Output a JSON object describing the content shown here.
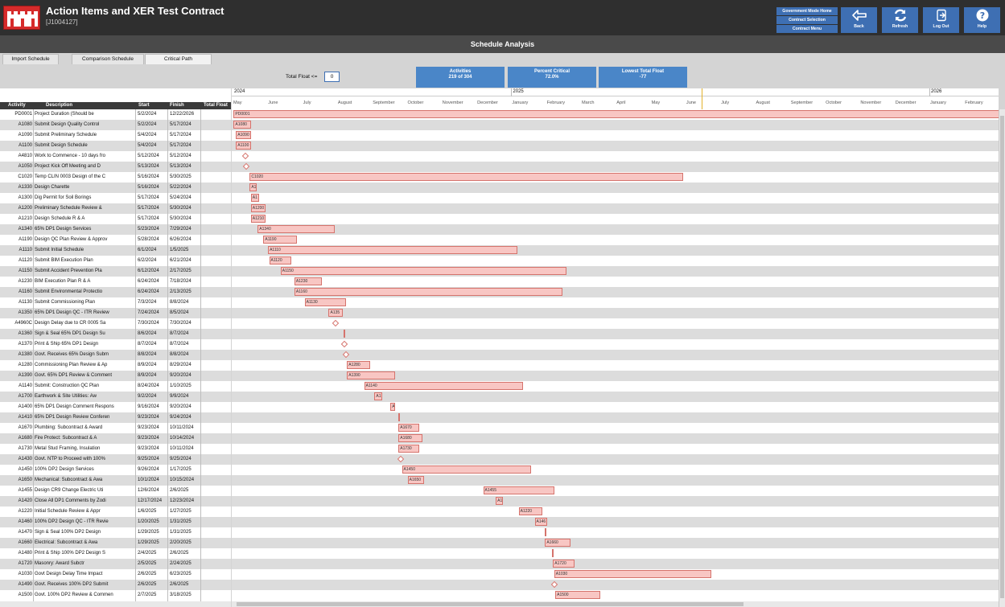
{
  "header": {
    "title": "Action Items and XER Test Contract",
    "subtitle": "[J1004127]",
    "menu_buttons": [
      "Government Mode Home",
      "Contract Selection",
      "Contract Menu"
    ],
    "buttons": [
      {
        "label": "Back",
        "icon": "back-arrow-icon"
      },
      {
        "label": "Refresh",
        "icon": "refresh-icon"
      },
      {
        "label": "Log Out",
        "icon": "logout-icon"
      },
      {
        "label": "Help",
        "icon": "help-icon"
      }
    ]
  },
  "section_title": "Schedule Analysis",
  "tabs": [
    "Import Schedule",
    "Comparison Schedule",
    "Critical Path"
  ],
  "active_tab": "Critical Path",
  "filter": {
    "label": "Total Float <=",
    "value": "0"
  },
  "stats": [
    {
      "title": "Activities",
      "value": "219 of 304"
    },
    {
      "title": "Percent Critical",
      "value": "72.0%"
    },
    {
      "title": "Lowest Total Float",
      "value": "-77"
    }
  ],
  "columns": [
    "Activity",
    "Description",
    "Start",
    "Finish",
    "Total Float"
  ],
  "timeline": {
    "years": [
      "2024",
      "2025",
      "2026"
    ],
    "months": [
      "May",
      "June",
      "July",
      "August",
      "September",
      "October",
      "November",
      "December",
      "January",
      "February",
      "March",
      "April",
      "May",
      "June",
      "July",
      "August",
      "September",
      "October",
      "November",
      "December",
      "January",
      "February"
    ]
  },
  "rows": [
    {
      "id": "PD0001",
      "desc": "Project Duration  (Should be",
      "start": "5/2/2024",
      "finish": "12/22/2026",
      "bar": "PD0001"
    },
    {
      "id": "A1080",
      "desc": "Submit Design Quality Control",
      "start": "5/2/2024",
      "finish": "5/17/2024",
      "bar": "A1080"
    },
    {
      "id": "A1090",
      "desc": "Submit Preliminary Schedule",
      "start": "5/4/2024",
      "finish": "5/17/2024",
      "bar": "A1090"
    },
    {
      "id": "A1100",
      "desc": "Submit Design Schedule",
      "start": "5/4/2024",
      "finish": "5/17/2024",
      "bar": "A1100"
    },
    {
      "id": "A4810",
      "desc": "Work to Commence - 10 days fro",
      "start": "5/12/2024",
      "finish": "5/12/2024",
      "bar": ""
    },
    {
      "id": "A1050",
      "desc": "Project Kick Off Meeting and D",
      "start": "5/13/2024",
      "finish": "5/13/2024",
      "bar": ""
    },
    {
      "id": "C1020",
      "desc": "Temp CLIN 0003 Design of the C",
      "start": "5/16/2024",
      "finish": "5/30/2025",
      "bar": "C1020"
    },
    {
      "id": "A1330",
      "desc": "Design Charette",
      "start": "5/16/2024",
      "finish": "5/22/2024",
      "bar": "A1"
    },
    {
      "id": "A1300",
      "desc": "Dig Permit for Soil Borings",
      "start": "5/17/2024",
      "finish": "5/24/2024",
      "bar": "A1"
    },
    {
      "id": "A1200",
      "desc": "Preliminary Schedule Review &",
      "start": "5/17/2024",
      "finish": "5/30/2024",
      "bar": "A1200"
    },
    {
      "id": "A1210",
      "desc": "Design Schedule R & A",
      "start": "5/17/2024",
      "finish": "5/30/2024",
      "bar": "A1210"
    },
    {
      "id": "A1340",
      "desc": "65% DP1 Design Services",
      "start": "5/23/2024",
      "finish": "7/29/2024",
      "bar": "A1340"
    },
    {
      "id": "A1190",
      "desc": "Design QC Plan Review & Approv",
      "start": "5/28/2024",
      "finish": "6/26/2024",
      "bar": "A1190"
    },
    {
      "id": "A1110",
      "desc": "Submit Initial Schedule",
      "start": "6/1/2024",
      "finish": "1/5/2025",
      "bar": "A1110"
    },
    {
      "id": "A1120",
      "desc": "Submit BIM Execution Plan",
      "start": "6/2/2024",
      "finish": "6/21/2024",
      "bar": "A1120"
    },
    {
      "id": "A1150",
      "desc": "Submit Accident Prevention Pla",
      "start": "6/12/2024",
      "finish": "2/17/2025",
      "bar": "A1150"
    },
    {
      "id": "A1230",
      "desc": "BIM Execution Plan R & A",
      "start": "6/24/2024",
      "finish": "7/18/2024",
      "bar": "A1230"
    },
    {
      "id": "A1160",
      "desc": "Submit Environmental Protectio",
      "start": "6/24/2024",
      "finish": "2/13/2025",
      "bar": "A1160"
    },
    {
      "id": "A1130",
      "desc": "Submit Commissioning Plan",
      "start": "7/3/2024",
      "finish": "8/8/2024",
      "bar": "A1130"
    },
    {
      "id": "A1350",
      "desc": "65% DP1 Design QC - ITR Review",
      "start": "7/24/2024",
      "finish": "8/5/2024",
      "bar": "A135"
    },
    {
      "id": "A4960C",
      "desc": "Design Delay due to CR 0005 Sa",
      "start": "7/30/2024",
      "finish": "7/30/2024",
      "bar": ""
    },
    {
      "id": "A1360",
      "desc": "Sign & Seal 65% DP1  Design Su",
      "start": "8/6/2024",
      "finish": "8/7/2024",
      "bar": ""
    },
    {
      "id": "A1370",
      "desc": "Print & Ship 65% DP1 Design",
      "start": "8/7/2024",
      "finish": "8/7/2024",
      "bar": ""
    },
    {
      "id": "A1380",
      "desc": "Govt. Receives 65% Design Subm",
      "start": "8/8/2024",
      "finish": "8/8/2024",
      "bar": ""
    },
    {
      "id": "A1280",
      "desc": "Commissioning Plan Review & Ap",
      "start": "8/9/2024",
      "finish": "8/29/2024",
      "bar": "A1280"
    },
    {
      "id": "A1390",
      "desc": "Govt. 65% DP1 Review & Comment",
      "start": "8/9/2024",
      "finish": "9/20/2024",
      "bar": "A1390"
    },
    {
      "id": "A1140",
      "desc": "Submit:  Construction QC Plan",
      "start": "8/24/2024",
      "finish": "1/10/2025",
      "bar": "A1140"
    },
    {
      "id": "A1700",
      "desc": "Earthwork & Site Utilities: Aw",
      "start": "9/2/2024",
      "finish": "9/9/2024",
      "bar": "A1"
    },
    {
      "id": "A1400",
      "desc": "65% DP1 Design Comment Respons",
      "start": "9/16/2024",
      "finish": "9/20/2024",
      "bar": "A"
    },
    {
      "id": "A1410",
      "desc": "65% DP1 Design Review Conferen",
      "start": "9/23/2024",
      "finish": "9/24/2024",
      "bar": ""
    },
    {
      "id": "A1670",
      "desc": "Plumbing:  Subcontract & Award",
      "start": "9/23/2024",
      "finish": "10/11/2024",
      "bar": "A1670"
    },
    {
      "id": "A1680",
      "desc": "Fire Protect:  Subcontract & A",
      "start": "9/23/2024",
      "finish": "10/14/2024",
      "bar": "A1680"
    },
    {
      "id": "A1730",
      "desc": "Metal Stud Framing, Insulation",
      "start": "9/23/2024",
      "finish": "10/11/2024",
      "bar": "A1730"
    },
    {
      "id": "A1430",
      "desc": "Govt. NTP to Proceed with 100%",
      "start": "9/25/2024",
      "finish": "9/25/2024",
      "bar": ""
    },
    {
      "id": "A1450",
      "desc": "100% DP2 Design Services",
      "start": "9/26/2024",
      "finish": "1/17/2025",
      "bar": "A1450"
    },
    {
      "id": "A1650",
      "desc": "Mechanical:  Subcontract & Awa",
      "start": "10/1/2024",
      "finish": "10/15/2024",
      "bar": "A1650"
    },
    {
      "id": "A1455",
      "desc": "Design CR9 Change Electric Uti",
      "start": "12/6/2024",
      "finish": "2/6/2025",
      "bar": "A1455"
    },
    {
      "id": "A1420",
      "desc": "Close All DP1 Comments by Zodi",
      "start": "12/17/2024",
      "finish": "12/23/2024",
      "bar": "A1"
    },
    {
      "id": "A1220",
      "desc": "Initial Schedule Review & Appr",
      "start": "1/6/2025",
      "finish": "1/27/2025",
      "bar": "A1220"
    },
    {
      "id": "A1460",
      "desc": "100% DP2 Design QC - ITR Revie",
      "start": "1/20/2025",
      "finish": "1/31/2025",
      "bar": "A146"
    },
    {
      "id": "A1470",
      "desc": "Sign & Seal 100% DP2 Design",
      "start": "1/29/2025",
      "finish": "1/31/2025",
      "bar": ""
    },
    {
      "id": "A1660",
      "desc": "Electrical:  Subcontract & Awa",
      "start": "1/29/2025",
      "finish": "2/20/2025",
      "bar": "A1660"
    },
    {
      "id": "A1480",
      "desc": "Print & Ship 100% DP2 Design S",
      "start": "2/4/2025",
      "finish": "2/6/2025",
      "bar": ""
    },
    {
      "id": "A1720",
      "desc": "Masonry: Award Subctr",
      "start": "2/5/2025",
      "finish": "2/24/2025",
      "bar": "A1720"
    },
    {
      "id": "A1030",
      "desc": "Govt Design Delay Time Impact",
      "start": "2/6/2025",
      "finish": "6/23/2025",
      "bar": "A1030"
    },
    {
      "id": "A1490",
      "desc": "Govt. Receives 100% DP2 Submit",
      "start": "2/6/2025",
      "finish": "2/6/2025",
      "bar": ""
    },
    {
      "id": "A1500",
      "desc": "Govt. 100% DP2 Review & Commen",
      "start": "2/7/2025",
      "finish": "3/18/2025",
      "bar": "A1500"
    }
  ]
}
